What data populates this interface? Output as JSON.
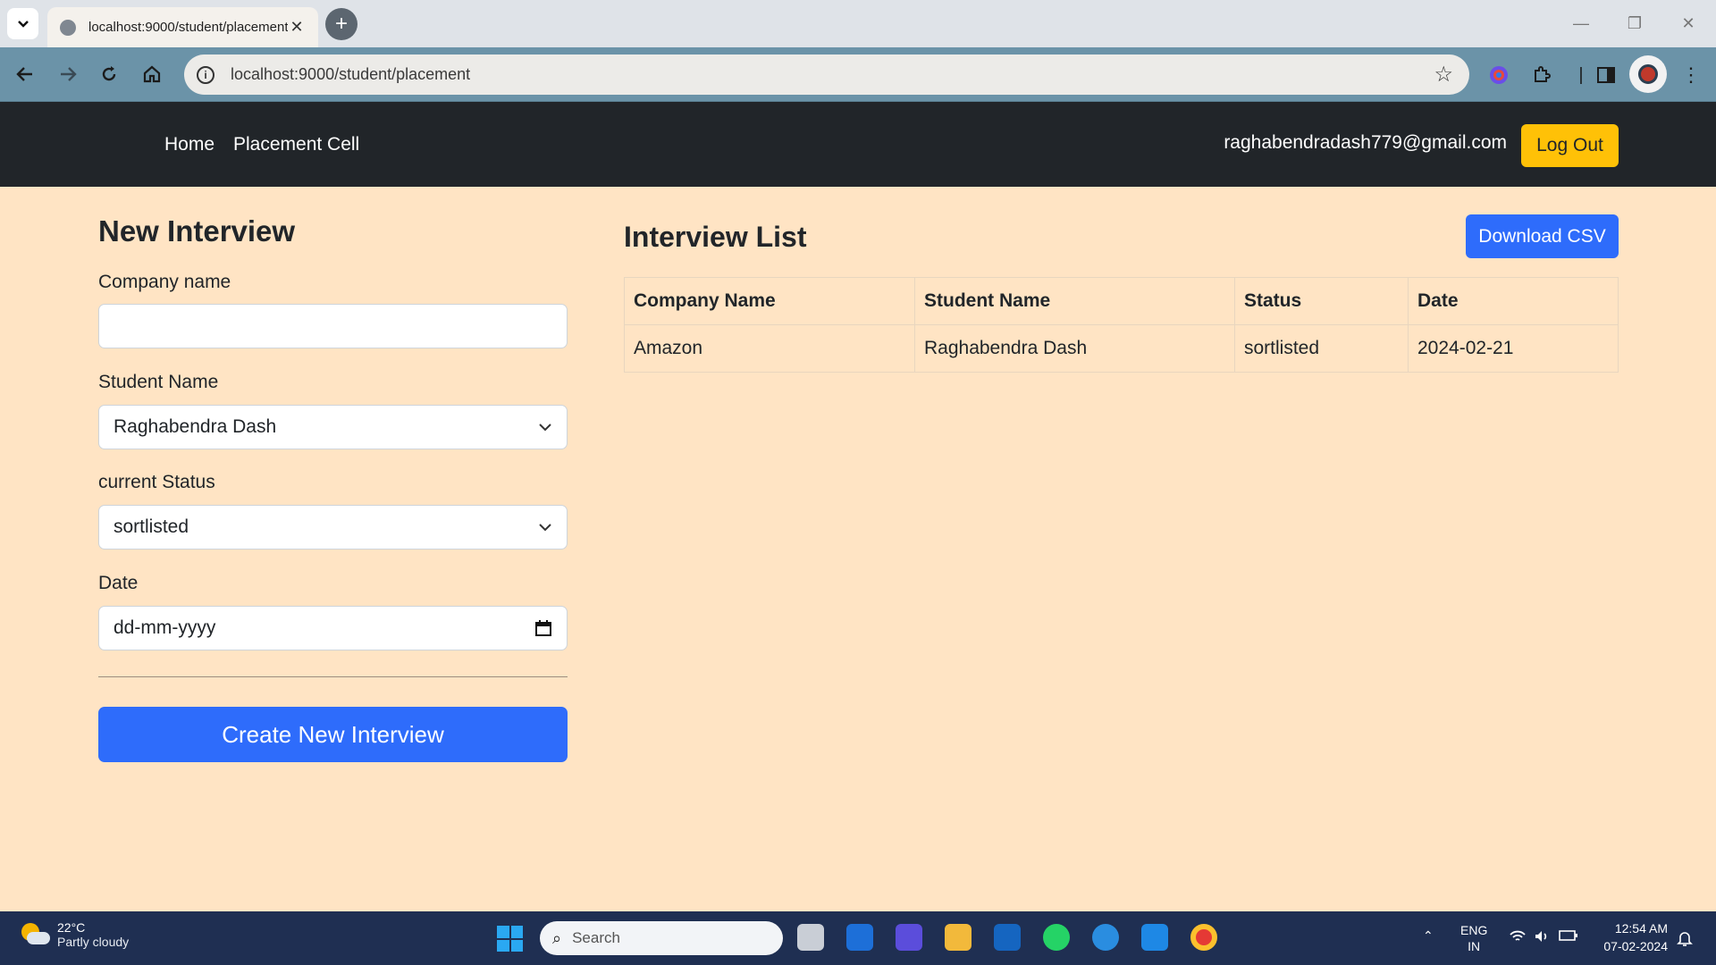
{
  "browser": {
    "tab_title": "localhost:9000/student/placement",
    "tab_close": "✕",
    "new_tab": "+",
    "url": "localhost:9000/student/placement",
    "window_controls": {
      "minimize": "—",
      "restore": "❐",
      "close": "✕"
    }
  },
  "navbar": {
    "links": [
      "Home",
      "Placement Cell"
    ],
    "user_email": "raghabendradash779@gmail.com",
    "logout_label": "Log Out"
  },
  "form": {
    "title": "New Interview",
    "company": {
      "label": "Company name",
      "value": ""
    },
    "student": {
      "label": "Student Name",
      "value": "Raghabendra Dash"
    },
    "status": {
      "label": "current Status",
      "value": "sortlisted"
    },
    "date": {
      "label": "Date",
      "placeholder": "dd-mm-yyyy"
    },
    "submit_label": "Create New Interview"
  },
  "interview_list": {
    "title": "Interview List",
    "download_label": "Download CSV",
    "columns": [
      "Company Name",
      "Student Name",
      "Status",
      "Date"
    ],
    "rows": [
      [
        "Amazon",
        "Raghabendra Dash",
        "sortlisted",
        "2024-02-21"
      ]
    ]
  },
  "taskbar": {
    "weather_temp": "22°C",
    "weather_condition": "Partly cloudy",
    "search_label": "Search",
    "language": "ENG",
    "region": "IN",
    "time": "12:54 AM",
    "date": "07-02-2024"
  },
  "colors": {
    "page_bg": "#ffe4c4",
    "navbar_bg": "#212529",
    "primary": "#2e6cfb",
    "warning": "#ffc107"
  }
}
